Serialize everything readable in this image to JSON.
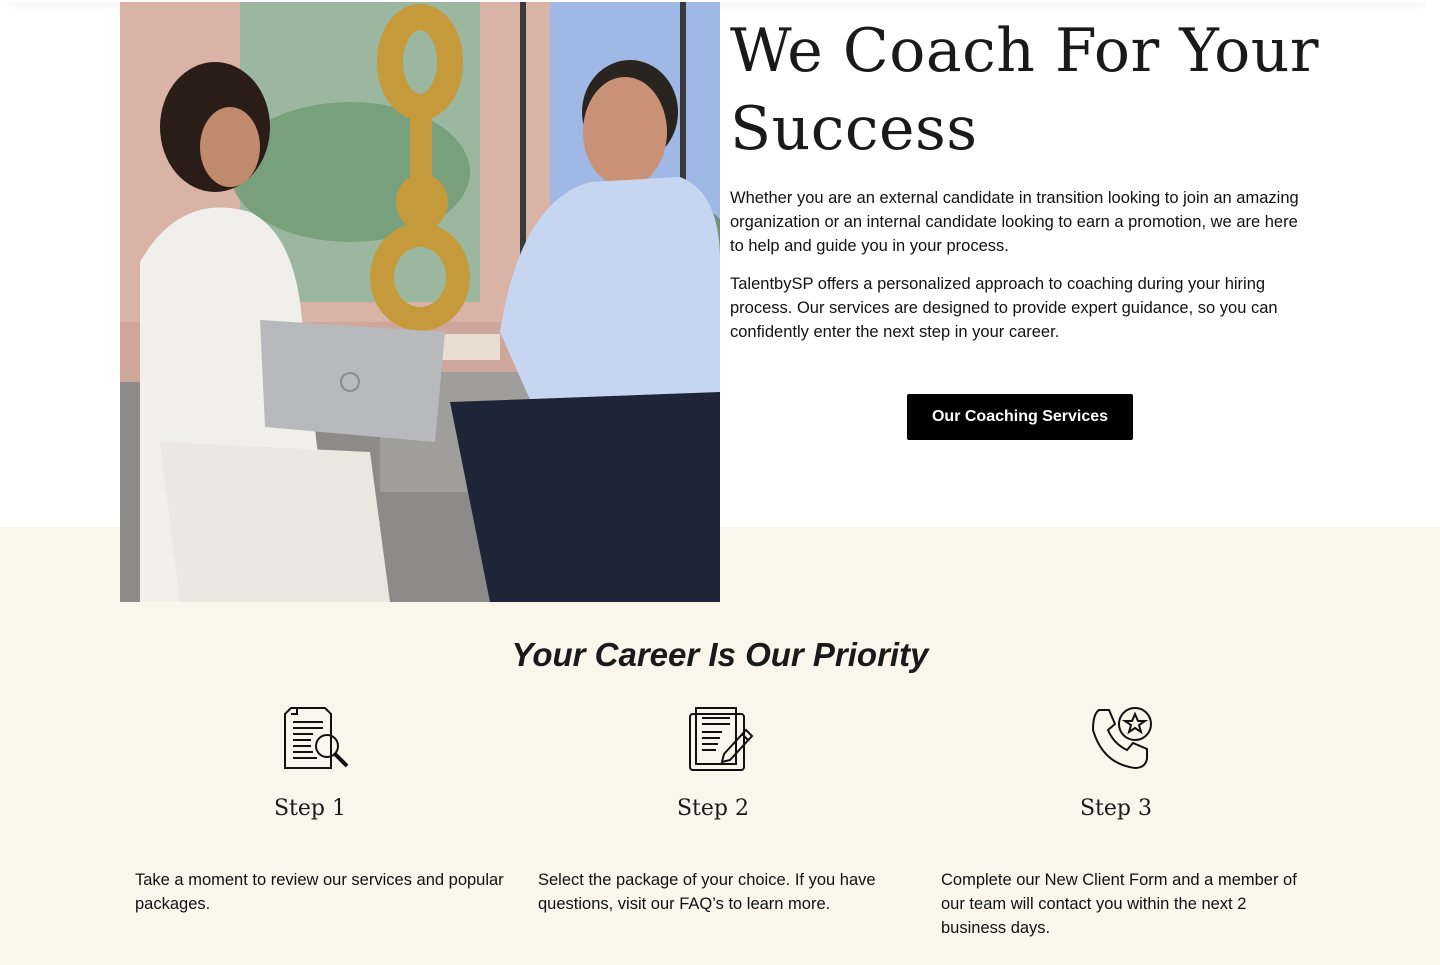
{
  "hero": {
    "title": "We Coach For Your Success",
    "paragraph_1": "Whether you are an external candidate in transition looking to join an amazing organization or an internal candidate looking to earn a promotion, we are here to help and guide you in your process.",
    "paragraph_2": "TalentbySP offers a personalized approach to coaching during your hiring process. Our services are designed to provide expert guidance, so you can confidently enter the next step in your career.",
    "cta_label": "Our Coaching Services",
    "image_alt": "Coach meeting with a client"
  },
  "priority": {
    "title": "Your Career Is Our Priority",
    "steps": [
      {
        "icon": "document-search-icon",
        "title": "Step 1",
        "description": "Take a moment to review our services and popular packages."
      },
      {
        "icon": "document-edit-icon",
        "title": "Step 2",
        "description": "Select the package of your choice. If you have questions, visit our FAQ’s to learn more."
      },
      {
        "icon": "phone-star-icon",
        "title": "Step 3",
        "description": "Complete our New Client Form and a member of our team will contact you within the next 2 business days."
      }
    ]
  },
  "colors": {
    "cta_background": "#000000",
    "section_background": "#faf6ec"
  }
}
